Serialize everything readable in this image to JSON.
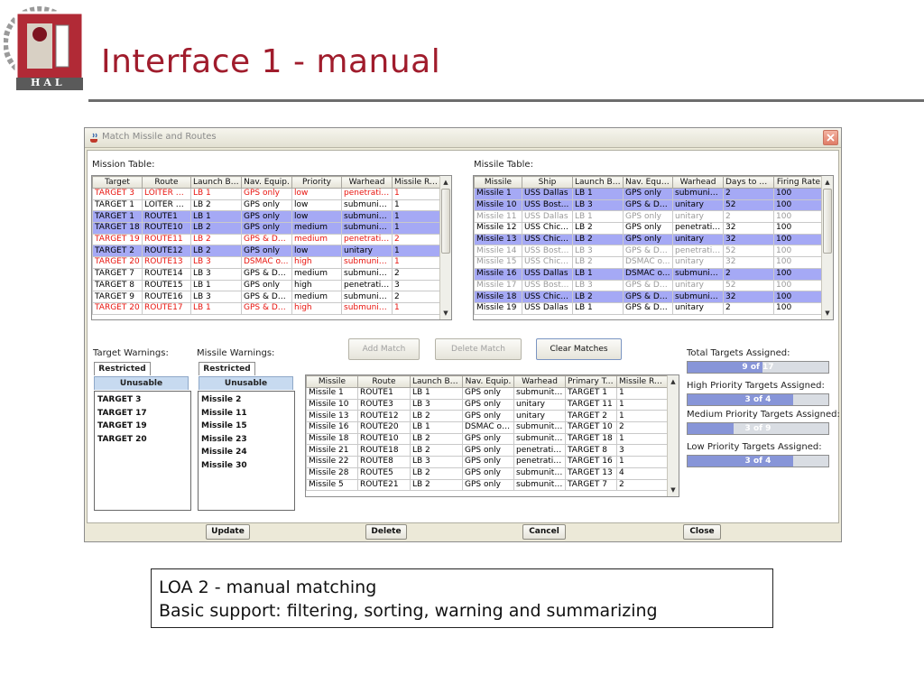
{
  "slide": {
    "title": "Interface 1 - manual",
    "logo_text": "HAL"
  },
  "dialog": {
    "title": "Match Missile and Routes"
  },
  "mission_table": {
    "label": "Mission Table:",
    "columns": [
      "Target",
      "Route",
      "Launch Ba...",
      "Nav. Equip.",
      "Priority",
      "Warhead",
      "Missile Re..."
    ],
    "rows": [
      {
        "cells": [
          "TARGET 3",
          "LOITER R...",
          "LB 1",
          "GPS only",
          "low",
          "penetrating",
          "1"
        ],
        "state": "warn"
      },
      {
        "cells": [
          "TARGET 1",
          "LOITER R...",
          "LB 2",
          "GPS only",
          "low",
          "submuniti...",
          "1"
        ],
        "state": ""
      },
      {
        "cells": [
          "TARGET 1",
          "ROUTE1",
          "LB 1",
          "GPS only",
          "low",
          "submuniti...",
          "1"
        ],
        "state": "sel"
      },
      {
        "cells": [
          "TARGET 18",
          "ROUTE10",
          "LB 2",
          "GPS only",
          "medium",
          "submuniti...",
          "1"
        ],
        "state": "sel"
      },
      {
        "cells": [
          "TARGET 19",
          "ROUTE11",
          "LB 2",
          "GPS & DS...",
          "medium",
          "penetrating",
          "2"
        ],
        "state": "warn"
      },
      {
        "cells": [
          "TARGET 2",
          "ROUTE12",
          "LB 2",
          "GPS only",
          "low",
          "unitary",
          "1"
        ],
        "state": "sel"
      },
      {
        "cells": [
          "TARGET 20",
          "ROUTE13",
          "LB 3",
          "DSMAC o...",
          "high",
          "submuniti...",
          "1"
        ],
        "state": "warn"
      },
      {
        "cells": [
          "TARGET 7",
          "ROUTE14",
          "LB 3",
          "GPS & DS...",
          "medium",
          "submuniti...",
          "2"
        ],
        "state": ""
      },
      {
        "cells": [
          "TARGET 8",
          "ROUTE15",
          "LB 1",
          "GPS only",
          "high",
          "penetrating",
          "3"
        ],
        "state": ""
      },
      {
        "cells": [
          "TARGET 9",
          "ROUTE16",
          "LB 3",
          "GPS & DS...",
          "medium",
          "submuniti...",
          "2"
        ],
        "state": ""
      },
      {
        "cells": [
          "TARGET 20",
          "ROUTE17",
          "LB 1",
          "GPS & DS...",
          "high",
          "submuniti...",
          "1"
        ],
        "state": "warn"
      }
    ]
  },
  "missile_table": {
    "label": "Missile Table:",
    "columns": [
      "Missile",
      "Ship",
      "Launch Ba...",
      "Nav. Equip.",
      "Warhead",
      "Days to Port",
      "Firing Rate"
    ],
    "rows": [
      {
        "cells": [
          "Missile 1",
          "USS Dallas",
          "LB 1",
          "GPS only",
          "submuniti...",
          "2",
          "100"
        ],
        "state": "sel"
      },
      {
        "cells": [
          "Missile 10",
          "USS Bost...",
          "LB 3",
          "GPS & DS...",
          "unitary",
          "52",
          "100"
        ],
        "state": "sel"
      },
      {
        "cells": [
          "Missile 11",
          "USS Dallas",
          "LB 1",
          "GPS only",
          "unitary",
          "2",
          "100"
        ],
        "state": "dim"
      },
      {
        "cells": [
          "Missile 12",
          "USS Chic...",
          "LB 2",
          "GPS only",
          "penetrating",
          "32",
          "100"
        ],
        "state": ""
      },
      {
        "cells": [
          "Missile 13",
          "USS Chic...",
          "LB 2",
          "GPS only",
          "unitary",
          "32",
          "100"
        ],
        "state": "sel"
      },
      {
        "cells": [
          "Missile 14",
          "USS Bost...",
          "LB 3",
          "GPS & DS...",
          "penetrating",
          "52",
          "100"
        ],
        "state": "dim"
      },
      {
        "cells": [
          "Missile 15",
          "USS Chic...",
          "LB 2",
          "DSMAC o...",
          "unitary",
          "32",
          "100"
        ],
        "state": "dim"
      },
      {
        "cells": [
          "Missile 16",
          "USS Dallas",
          "LB 1",
          "DSMAC o...",
          "submuniti...",
          "2",
          "100"
        ],
        "state": "sel"
      },
      {
        "cells": [
          "Missile 17",
          "USS Bost...",
          "LB 3",
          "GPS & DS...",
          "unitary",
          "52",
          "100"
        ],
        "state": "dim"
      },
      {
        "cells": [
          "Missile 18",
          "USS Chic...",
          "LB 2",
          "GPS & DS...",
          "submuniti...",
          "32",
          "100"
        ],
        "state": "sel"
      },
      {
        "cells": [
          "Missile 19",
          "USS Dallas",
          "LB 1",
          "GPS & DS...",
          "unitary",
          "2",
          "100"
        ],
        "state": ""
      }
    ]
  },
  "target_warnings": {
    "label": "Target Warnings:",
    "tabs": [
      "Restricted",
      "Unusable"
    ],
    "items": [
      "TARGET 3",
      "TARGET 17",
      "TARGET 19",
      "TARGET 20"
    ]
  },
  "missile_warnings": {
    "label": "Missile Warnings:",
    "tabs": [
      "Restricted",
      "Unusable"
    ],
    "items": [
      "Missile 2",
      "Missile 11",
      "Missile 15",
      "Missile 23",
      "Missile 24",
      "Missile 30"
    ]
  },
  "actions": {
    "add_match": "Add Match",
    "delete_match": "Delete Match",
    "clear_matches": "Clear Matches"
  },
  "match_table": {
    "columns": [
      "Missile",
      "Route",
      "Launch Ba...",
      "Nav. Equip.",
      "Warhead",
      "Primary Tar...",
      "Missile Re..."
    ],
    "rows": [
      {
        "cells": [
          "Missile 1",
          "ROUTE1",
          "LB 1",
          "GPS only",
          "submuniti...",
          "TARGET 1",
          "1"
        ]
      },
      {
        "cells": [
          "Missile 10",
          "ROUTE3",
          "LB 3",
          "GPS only",
          "unitary",
          "TARGET 11",
          "1"
        ]
      },
      {
        "cells": [
          "Missile 13",
          "ROUTE12",
          "LB 2",
          "GPS only",
          "unitary",
          "TARGET 2",
          "1"
        ]
      },
      {
        "cells": [
          "Missile 16",
          "ROUTE20",
          "LB 1",
          "DSMAC only",
          "submuniti...",
          "TARGET 10",
          "2"
        ]
      },
      {
        "cells": [
          "Missile 18",
          "ROUTE10",
          "LB 2",
          "GPS only",
          "submuniti...",
          "TARGET 18",
          "1"
        ]
      },
      {
        "cells": [
          "Missile 21",
          "ROUTE18",
          "LB 2",
          "GPS only",
          "penetrating",
          "TARGET 8",
          "3"
        ]
      },
      {
        "cells": [
          "Missile 22",
          "ROUTE8",
          "LB 3",
          "GPS only",
          "penetrating",
          "TARGET 16",
          "1"
        ]
      },
      {
        "cells": [
          "Missile 28",
          "ROUTE5",
          "LB 2",
          "GPS only",
          "submuniti...",
          "TARGET 13",
          "4"
        ]
      },
      {
        "cells": [
          "Missile 5",
          "ROUTE21",
          "LB 2",
          "GPS only",
          "submuniti...",
          "TARGET 7",
          "2"
        ]
      }
    ]
  },
  "summary": {
    "total": {
      "label": "Total Targets Assigned:",
      "text": "9 of 17",
      "fraction": 0.53
    },
    "high": {
      "label": "High Priority Targets Assigned:",
      "text": "3 of 4",
      "fraction": 0.75
    },
    "medium": {
      "label": "Medium Priority Targets Assigned:",
      "text": "3 of 9",
      "fraction": 0.33
    },
    "low": {
      "label": "Low Priority Targets Assigned:",
      "text": "3 of 4",
      "fraction": 0.75
    }
  },
  "bottom_buttons": {
    "update": "Update",
    "delete": "Delete",
    "cancel": "Cancel",
    "close": "Close"
  },
  "caption": {
    "line1": "LOA 2 - manual matching",
    "line2": "Basic support: filtering, sorting, warning and summarizing"
  },
  "colors": {
    "title_red": "#a01c2c",
    "selected_row": "#a5a9f5",
    "warning_text": "#e8140e",
    "progress_fill": "#8795d8"
  }
}
